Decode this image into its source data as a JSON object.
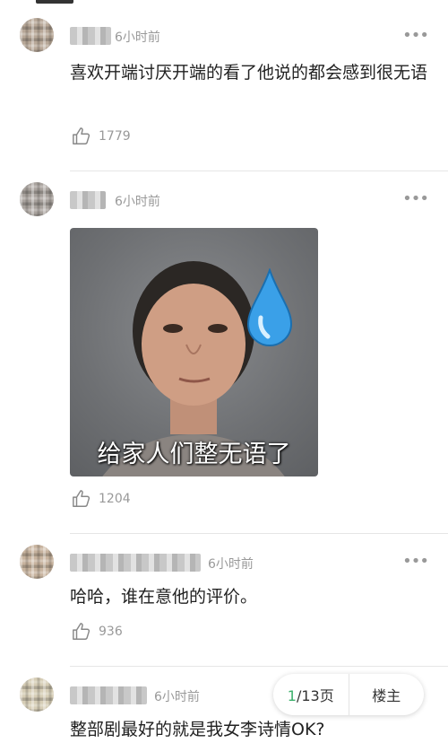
{
  "comments": [
    {
      "time": "6小时前",
      "text": "喜欢开端讨厌开端的看了他说的都会感到很无语",
      "likes": "1779",
      "more": "•••"
    },
    {
      "time": "6小时前",
      "image_caption": "给家人们整无语了",
      "likes": "1204",
      "more": "•••"
    },
    {
      "time": "6小时前",
      "text": "哈哈，谁在意他的评价。",
      "likes": "936",
      "more": "•••"
    },
    {
      "time": "6小时前",
      "text": "整部剧最好的就是我女李诗情OK?"
    }
  ],
  "pager": {
    "current": "1",
    "rest": "/13页",
    "op_label": "楼主"
  },
  "colors": {
    "accent": "#3bb06b",
    "muted": "#999999",
    "text": "#222222"
  },
  "icons": {
    "like": "thumbs-up-icon",
    "more": "more-dots-icon",
    "sweat": "sweat-drop-icon"
  }
}
